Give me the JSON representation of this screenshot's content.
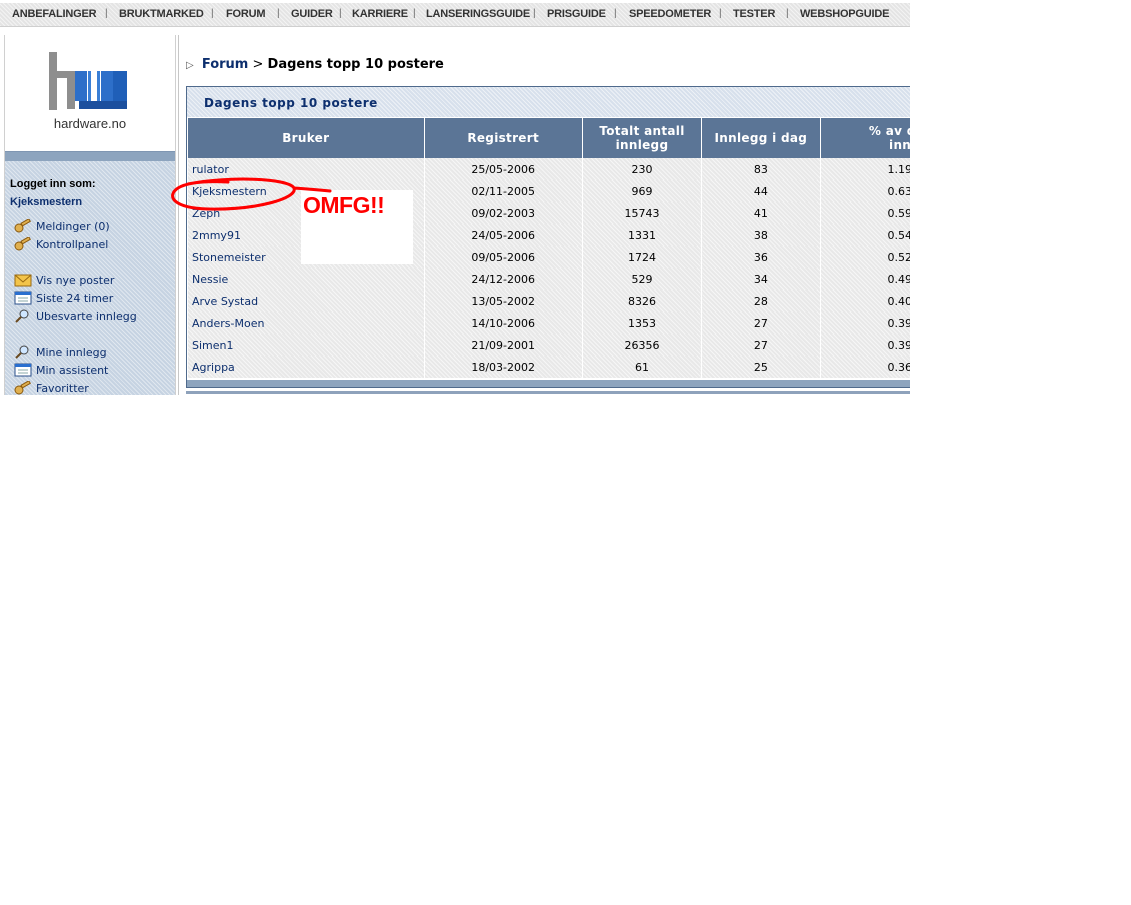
{
  "top_nav": [
    "ANBEFALINGER",
    "BRUKTMARKED",
    "FORUM",
    "GUIDER",
    "KARRIERE",
    "LANSERINGSGUIDE",
    "PRISGUIDE",
    "SPEEDOMETER",
    "TESTER",
    "WEBSHOPGUIDE"
  ],
  "logo": {
    "text": "hardware.no"
  },
  "sidebar": {
    "logged_in_label": "Logget inn som:",
    "username": "Kjeksmestern",
    "links": [
      {
        "label": "Meldinger (0)",
        "icon": "key-icon"
      },
      {
        "label": "Kontrollpanel",
        "icon": "key-icon"
      },
      {
        "label": "Vis nye poster",
        "icon": "envelope-icon"
      },
      {
        "label": "Siste 24 timer",
        "icon": "calendar-icon"
      },
      {
        "label": "Ubesvarte innlegg",
        "icon": "magnifier-icon"
      },
      {
        "label": "Mine innlegg",
        "icon": "magnifier-icon"
      },
      {
        "label": "Min assistent",
        "icon": "calendar-icon"
      },
      {
        "label": "Favoritter",
        "icon": "key-icon"
      }
    ]
  },
  "breadcrumb": {
    "link": "Forum",
    "separator": ">",
    "current": "Dagens topp 10 postere"
  },
  "panel": {
    "title": "Dagens topp 10 postere"
  },
  "table": {
    "headers": [
      {
        "line1": "Bruker",
        "line2": ""
      },
      {
        "line1": "Registrert",
        "line2": ""
      },
      {
        "line1": "Totalt antall",
        "line2": "innlegg"
      },
      {
        "line1": "Innlegg i dag",
        "line2": ""
      },
      {
        "line1": "% av da",
        "line2": "innle"
      }
    ],
    "rows": [
      [
        "rulator",
        "25/05-2006",
        "230",
        "83",
        "1.19"
      ],
      [
        "Kjeksmestern",
        "02/11-2005",
        "969",
        "44",
        "0.63"
      ],
      [
        "Zeph",
        "09/02-2003",
        "15743",
        "41",
        "0.59"
      ],
      [
        "2mmy91",
        "24/05-2006",
        "1331",
        "38",
        "0.54"
      ],
      [
        "Stonemeister",
        "09/05-2006",
        "1724",
        "36",
        "0.52"
      ],
      [
        "Nessie",
        "24/12-2006",
        "529",
        "34",
        "0.49"
      ],
      [
        "Arve Systad",
        "13/05-2002",
        "8326",
        "28",
        "0.40"
      ],
      [
        "Anders-Moen",
        "14/10-2006",
        "1353",
        "27",
        "0.39"
      ],
      [
        "Simen1",
        "21/09-2001",
        "26356",
        "27",
        "0.39"
      ],
      [
        "Agrippa",
        "18/03-2002",
        "61",
        "25",
        "0.36"
      ]
    ]
  },
  "annotation": {
    "text": "OMFG!!",
    "color": "#ff0000"
  },
  "colors": {
    "header_bg": "#5b7596",
    "link": "#0d2f6e",
    "sidebar_bg": "#c6d3e2"
  }
}
